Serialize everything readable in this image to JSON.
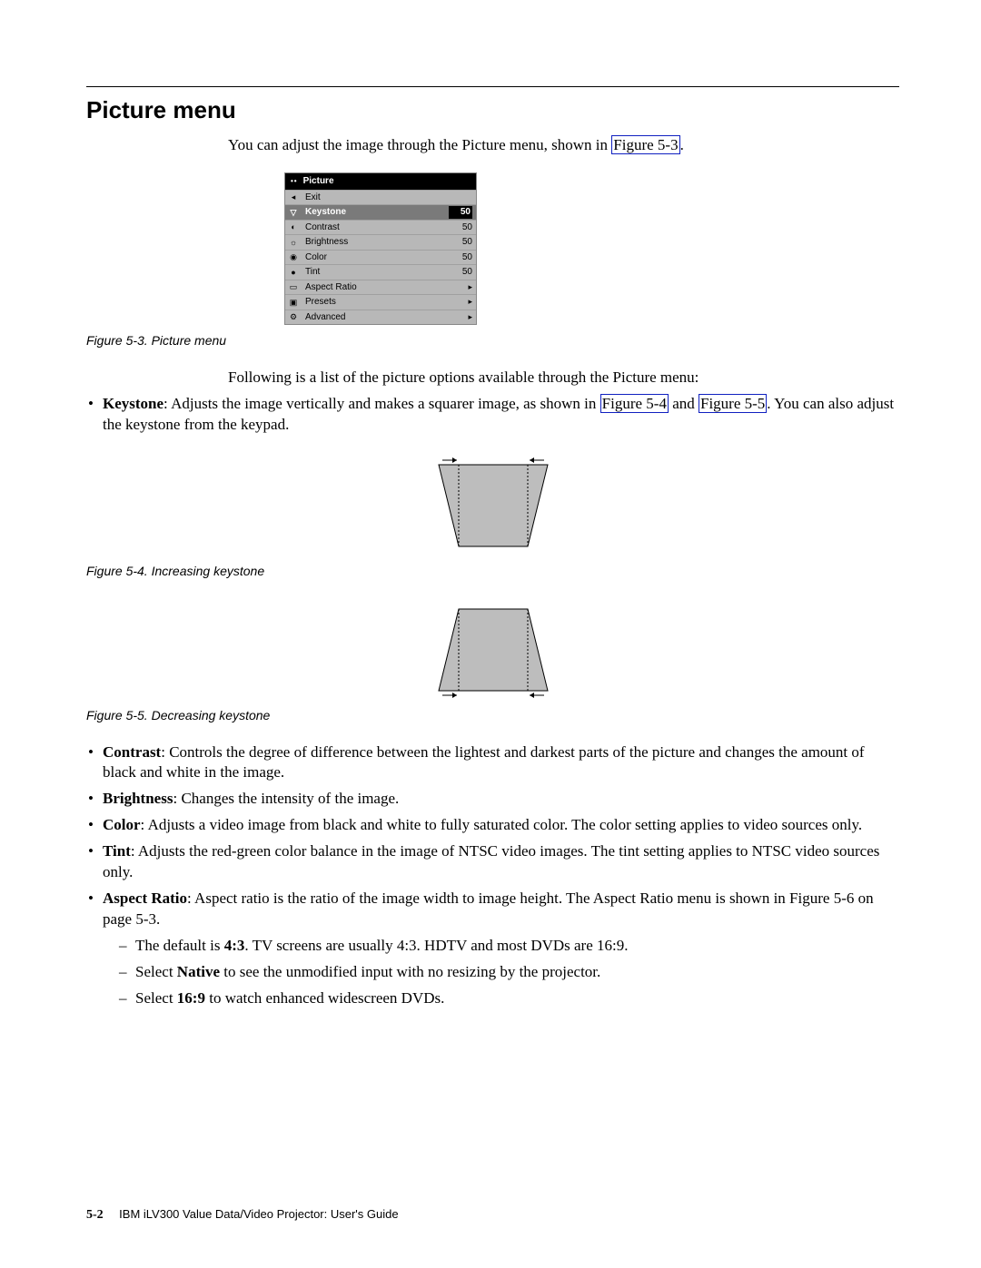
{
  "heading": "Picture menu",
  "intro_pre": "You can adjust the image through the Picture menu, shown in ",
  "intro_link": "Figure 5-3",
  "intro_post": ".",
  "menu": {
    "title": "Picture",
    "rows": [
      {
        "label": "Exit",
        "value": "",
        "selected": false,
        "arrow": false
      },
      {
        "label": "Keystone",
        "value": "50",
        "selected": true,
        "arrow": false
      },
      {
        "label": "Contrast",
        "value": "50",
        "selected": false,
        "arrow": false
      },
      {
        "label": "Brightness",
        "value": "50",
        "selected": false,
        "arrow": false
      },
      {
        "label": "Color",
        "value": "50",
        "selected": false,
        "arrow": false
      },
      {
        "label": "Tint",
        "value": "50",
        "selected": false,
        "arrow": false
      },
      {
        "label": "Aspect Ratio",
        "value": "",
        "selected": false,
        "arrow": true
      },
      {
        "label": "Presets",
        "value": "",
        "selected": false,
        "arrow": true
      },
      {
        "label": "Advanced",
        "value": "",
        "selected": false,
        "arrow": true
      }
    ]
  },
  "fig3_caption": "Figure 5-3. Picture menu",
  "following_intro": "Following is a list of the picture options available through the Picture menu:",
  "keystone_bold": "Keystone",
  "keystone_text_a": ": Adjusts the image vertically and makes a squarer image, as shown in ",
  "keystone_link1": "Figure 5-4",
  "keystone_mid": " and ",
  "keystone_link2": "Figure 5-5",
  "keystone_text_b": ". You can also adjust the keystone from the keypad.",
  "fig4_caption": "Figure 5-4. Increasing keystone",
  "fig5_caption": "Figure 5-5. Decreasing keystone",
  "contrast_bold": "Contrast",
  "contrast_text": ": Controls the degree of difference between the lightest and darkest parts of the picture and changes the amount of black and white in the image.",
  "brightness_bold": "Brightness",
  "brightness_text": ": Changes the intensity of the image.",
  "color_bold": "Color",
  "color_text": ": Adjusts a video image from black and white to fully saturated color. The color setting applies to video sources only.",
  "tint_bold": "Tint",
  "tint_text": ": Adjusts the red-green color balance in the image of NTSC video images. The tint setting applies to NTSC video sources only.",
  "aspect_bold": "Aspect Ratio",
  "aspect_text": ": Aspect ratio is the ratio of the image width to image height. The Aspect Ratio menu is shown in Figure 5-6 on page 5-3.",
  "dash1_pre": "The default is ",
  "dash1_bold": "4:3",
  "dash1_post": ". TV screens are usually 4:3. HDTV and most DVDs are 16:9.",
  "dash2_pre": "Select ",
  "dash2_bold": "Native",
  "dash2_post": " to see the unmodified input with no resizing by the projector.",
  "dash3_pre": "Select ",
  "dash3_bold": "16:9",
  "dash3_post": " to watch enhanced widescreen DVDs.",
  "footer_page": "5-2",
  "footer_title": "IBM iLV300 Value Data/Video Projector: User's Guide"
}
